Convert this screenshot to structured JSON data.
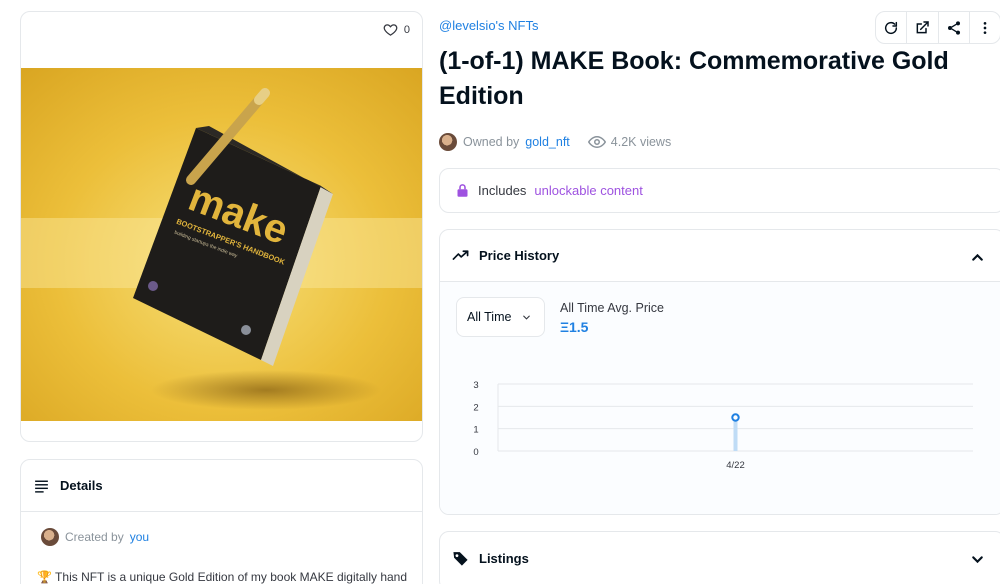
{
  "left": {
    "like_count": "0",
    "details_heading": "Details",
    "created_by_prefix": "Created by",
    "created_by_name": "you",
    "description": "🏆 This NFT is a unique Gold Edition of my book MAKE digitally hand"
  },
  "artwork": {
    "cover_title": "make",
    "cover_subtitle": "BOOTSTRAPPER'S HANDBOOK",
    "cover_tagline": "building startups the indie way",
    "colors": {
      "background": "#e9b62f",
      "book": "#1e1c1a",
      "title": "#e2b53c",
      "pen": "#c9a44c"
    }
  },
  "header": {
    "collection": "@levelsio's NFTs",
    "title": "(1-of-1) MAKE Book: Commemorative Gold Edition",
    "owned_prefix": "Owned by",
    "owner": "gold_nft",
    "views": "4.2K views"
  },
  "unlockable": {
    "prefix": "Includes",
    "link": "unlockable content"
  },
  "price_history": {
    "heading": "Price History",
    "time_filter": "All Time",
    "avg_label": "All Time Avg. Price",
    "avg_value": "Ξ1.5"
  },
  "listings": {
    "heading": "Listings"
  },
  "colors": {
    "accent": "#2081e2",
    "purple": "#9e52e0",
    "border": "#e5e8eb",
    "point": "#2081e2"
  },
  "chart_data": {
    "type": "line",
    "x": [
      "4/22"
    ],
    "series": [
      {
        "values": [
          1.5
        ]
      }
    ],
    "yticks": [
      "0",
      "1",
      "2",
      "3"
    ],
    "ylim": [
      0,
      3
    ],
    "grid": true
  }
}
